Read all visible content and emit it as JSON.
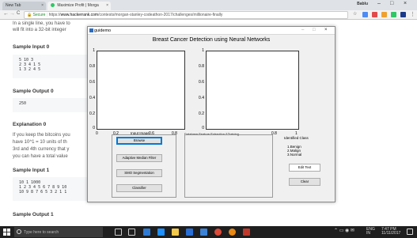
{
  "browser": {
    "tabs": [
      {
        "label": "New Tab"
      },
      {
        "label": "Maximize Profit | Morga"
      }
    ],
    "profile": "Bablu",
    "window_controls": {
      "minimize": "–",
      "maximize": "□",
      "close": "×"
    },
    "nav": {
      "back": "←",
      "forward": "→",
      "reload": "C"
    },
    "address": {
      "secure_label": "Secure",
      "scheme": "https://",
      "domain": "www.hackerrank.com",
      "path": "/contests/morgan-stanley-codeathon-2017/challenges/millionaire-finally"
    }
  },
  "page": {
    "intro_line1": "In a single line, you have to",
    "intro_line2": "will fit into a 32-bit integer",
    "sample_input0_heading": "Sample Input 0",
    "sample_input0_lines": "5 10 3\n2 3 4 1 5\n1 3 2 4 5",
    "sample_output0_heading": "Sample Output 0",
    "sample_output0_value": "250",
    "explanation0_heading": "Explanation 0",
    "explanation_line1": "If you keep the bitcoins you",
    "explanation_line2": "have 10^1 = 10 units of th",
    "explanation_line3": "3rd and 4th currency that y",
    "explanation_line4": "you can have a total value",
    "sample_input1_heading": "Sample Input 1",
    "sample_input1_lines": "10 1 1000\n1 2 3 4 5 6 7 8 9 10\n10 9 8 7 6 5 3 2 1 1",
    "sample_output1_heading": "Sample Output 1"
  },
  "guidemo": {
    "window_title": "guidemo",
    "heading": "Breast Cancer Detection using Neural Networks",
    "left_axes": {
      "yticks": [
        "1",
        "0.8",
        "0.6",
        "0.4",
        "0.2",
        "0"
      ],
      "xticks": [
        "0",
        "0.2",
        "0.4",
        "0.6",
        "0.8"
      ],
      "input_label": "Input Image"
    },
    "right_axes": {
      "yticks": [
        "1",
        "0.8",
        "0.6",
        "0.4",
        "0.2",
        "0"
      ],
      "xticks": [
        "0.2",
        "0.4",
        "0.6",
        "0.8",
        "1"
      ],
      "database_label": "Database Feature Extraction &Training"
    },
    "buttons": {
      "browse": "Browse",
      "median_filter": "Adaptive Median Filter",
      "segmentation": "SMO Segmentation",
      "classifier": "Classifier",
      "edit_text": "Edit Text",
      "clear": "Clear"
    },
    "identified_class": {
      "title": "Identified Class",
      "items": [
        "1.Benign",
        "2.Malign",
        "3.Normal"
      ]
    }
  },
  "taskbar": {
    "search_placeholder": "Type here to search",
    "tray_lang": "ENG",
    "tray_region": "IN",
    "time": "7:47 PM",
    "date": "11/11/2017"
  },
  "colors": {
    "accent_blue": "#0078d7",
    "hackerrank_green": "#2ec866",
    "taskbar": "#1f1f1f"
  }
}
